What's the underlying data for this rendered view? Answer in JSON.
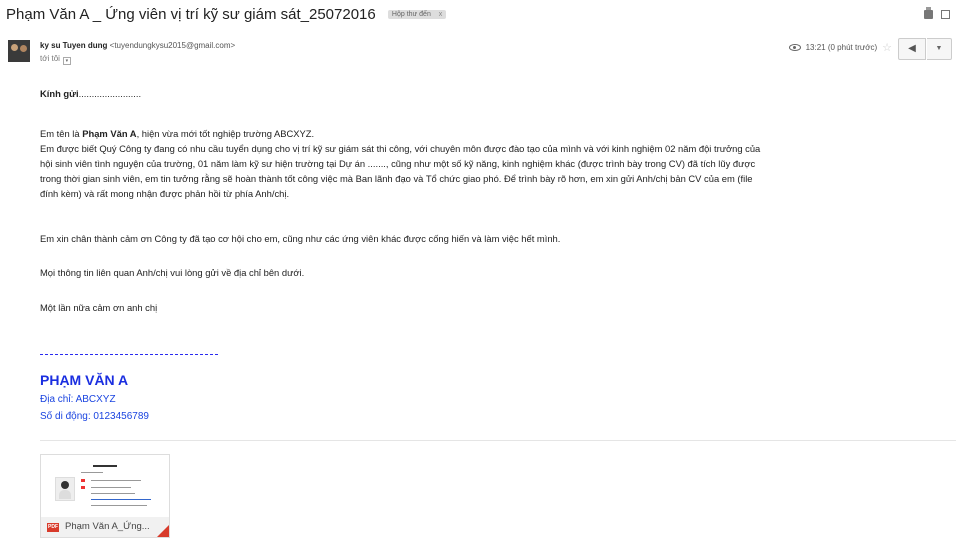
{
  "email": {
    "subject": "Phạm Văn A _ Ứng viên vị trí kỹ sư giám sát_25072016",
    "label": "Hộp thư đến",
    "label_close": "x",
    "sender_name": "ky su Tuyen dung",
    "sender_email": "<tuyendungkysu2015@gmail.com>",
    "recipient": "tới tôi",
    "time": "13:21 (0 phút trước)",
    "reply_icon": "reply-icon",
    "more_icon": "chevron-down-icon"
  },
  "body": {
    "greeting_bold": "Kính gửi",
    "greeting_rest": "........................",
    "intro_1": "Em tên là ",
    "intro_name": "Phạm Văn A",
    "intro_2": ", hiện vừa mới tốt nghiệp trường ABCXYZ.",
    "para_lines": [
      "Em được biết Quý Công ty đang có nhu cầu tuyển dụng cho vị trí kỹ sư giám sát thi công, với chuyên môn được đào tạo của mình và với kinh nghiệm 02 năm đội trưởng của",
      "hội sinh viên tình nguyện của trường, 01 năm làm kỹ sư hiện trường tại Dự án ......., cũng như một số kỹ năng, kinh nghiệm khác (được trình bày trong CV) đã tích lũy được",
      "trong thời gian sinh viên, em tin tưởng rằng sẽ hoàn thành tốt công việc mà Ban lãnh đạo và Tổ chức giao phó. Để trình bày rõ hơn, em xin gửi Anh/chị bản CV của em (file",
      "đính kèm) và rất mong nhận được phản hồi từ phía Anh/chị."
    ],
    "thanks": "Em xin chân thành cảm ơn Công ty đã tạo cơ hội cho em, cũng như các ứng viên khác được cống hiến và làm việc hết mình.",
    "contact": "Mọi thông tin liên quan Anh/chị vui lòng gửi về địa chỉ bên dưới.",
    "closing": "Một lần nữa cảm ơn anh chị"
  },
  "signature": {
    "name": "PHẠM VĂN A",
    "address": "Địa chỉ: ABCXYZ",
    "phone": "Số di động: 0123456789"
  },
  "attachment": {
    "type_label": "PDF",
    "filename": "Phạm Văn A_Ứng..."
  },
  "colors": {
    "signature_blue": "#1a2ee0",
    "pdf_red": "#d83b2b"
  }
}
